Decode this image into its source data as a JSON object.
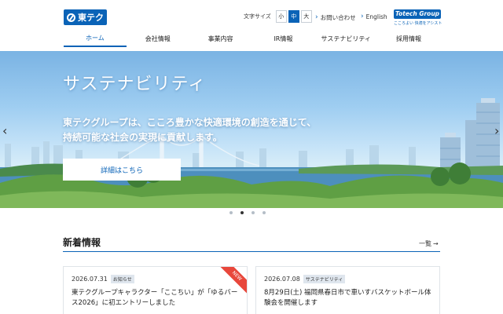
{
  "header": {
    "logo_text": "東テク",
    "font_size_label": "文字サイズ",
    "font_sizes": [
      {
        "label": "小",
        "active": false
      },
      {
        "label": "中",
        "active": true
      },
      {
        "label": "大",
        "active": false
      }
    ],
    "contact_label": "お問い合わせ",
    "english_label": "English",
    "group_logo_text": "Totech Group",
    "group_logo_tagline": "こころよい 快適をアシスト"
  },
  "nav": {
    "items": [
      {
        "label": "ホーム",
        "active": true
      },
      {
        "label": "会社情報",
        "active": false
      },
      {
        "label": "事業内容",
        "active": false
      },
      {
        "label": "IR情報",
        "active": false
      },
      {
        "label": "サステナビリティ",
        "active": false
      },
      {
        "label": "採用情報",
        "active": false
      }
    ]
  },
  "hero": {
    "title": "サステナビリティ",
    "text_line1": "東テクグループは、こころ豊かな快適環境の創造を通じて、",
    "text_line2": "持続可能な社会の実現に貢献します。",
    "button_label": "詳細はこちら",
    "prev_icon": "chevron-left-icon",
    "next_icon": "chevron-right-icon",
    "slide_count": 4,
    "active_slide": 2
  },
  "news": {
    "heading": "新着情報",
    "list_link": "一覧",
    "cards": [
      {
        "date": "2026.07.31",
        "tag": "お知らせ",
        "title": "東テクグループキャラクター「ここちい」が「ゆるバース2026」に初エントリーしました",
        "new_badge": "NEW"
      },
      {
        "date": "2026.07.08",
        "tag": "サステナビリティ",
        "title": "8月29日(土) 福岡県春日市で車いすバスケットボール体験会を開催します",
        "new_badge": ""
      }
    ]
  },
  "colors": {
    "brand_blue": "#0a63b7",
    "new_badge": "#e8473b"
  }
}
